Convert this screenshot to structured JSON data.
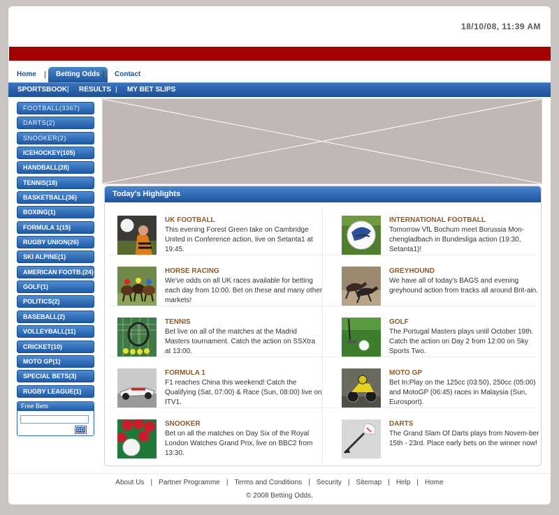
{
  "header": {
    "datetime": "18/10/08, 11:39 AM"
  },
  "top_nav": [
    {
      "label": "Home",
      "active": false
    },
    {
      "label": "Betting Odds",
      "active": true
    },
    {
      "label": "Contact",
      "active": false
    }
  ],
  "sub_nav": [
    "SPORTSBOOK",
    "RESULTS",
    "MY BET SLIPS"
  ],
  "sports": [
    "FOOTBALL(3367)",
    "DARTS(2)",
    "SNOOKER(2)",
    "ICEHOCKEY(105)",
    "HANDBALL(28)",
    "TENNIS(18)",
    "BASKETBALL(36)",
    "BOXING(1)",
    "FORMULA 1(15)",
    "RUGBY UNION(26)",
    "SKI ALPINE(1)",
    "AMERICAN FOOTB.(24)",
    "GOLF(1)",
    "POLITICS(2)",
    "BASEBALL(2)",
    "VOLLEYBALL(11)",
    "CRICKET(10)",
    "MOTO GP(1)",
    "SPECIAL BETS(3)",
    "RUGBY LEAGUE(1)"
  ],
  "free_bets": {
    "title": "Free Bets",
    "value": "",
    "go_label": "GO"
  },
  "highlights": {
    "title": "Today's Highlights",
    "items": [
      {
        "title": "UK FOOTBALL",
        "text": "This evening Forest Green take on Cambridge United in Conference action, live on Setanta1 at 19:45.",
        "icon": "football-player-icon"
      },
      {
        "title": "INTERNATIONAL FOOTBALL",
        "text": "Tomorrow VfL Bochum meet Borussia Mon-chengladbach in Bundesliga action (19:30, Setanta1)!",
        "icon": "soccer-ball-icon"
      },
      {
        "title": "HORSE RACING",
        "text": "We've odds on all UK races available for betting each day from 10:00. Bet on these and many other markets!",
        "icon": "horse-racing-icon"
      },
      {
        "title": "GREYHOUND",
        "text": "We have all of today's BAGS and evening greyhound action from tracks all around Brit-ain.",
        "icon": "greyhound-icon"
      },
      {
        "title": "TENNIS",
        "text": "Bet live on all of the matches at the Madrid Masters tournament. Catch the action on SSXtra at 13:00.",
        "icon": "tennis-racket-icon"
      },
      {
        "title": "GOLF",
        "text": "The Portugal Masters plays until October 19th. Catch the action on Day 2 from 12:00 on Sky Sports Two.",
        "icon": "golf-ball-icon"
      },
      {
        "title": "FORMULA 1",
        "text": "F1 reaches China this weekend! Catch the Qualifying (Sat, 07:00) & Race (Sun, 08:00) live on ITV1.",
        "icon": "race-car-icon"
      },
      {
        "title": "MOTO GP",
        "text": "Bet In:Play on the 125cc (03:50), 250cc (05:00) and MotoGP (06:45) races in Malaysia (Sun, Eurosport).",
        "icon": "motorbike-icon"
      },
      {
        "title": "SNOOKER",
        "text": "Bet on all the matches on Day Six of the Royal London Watches Grand Prix, live on BBC2 from 13:30.",
        "icon": "snooker-balls-icon"
      },
      {
        "title": "DARTS",
        "text": "The Grand Slam Of Darts plays from Novem-ber 15th - 23rd. Place early bets on the winner now!",
        "icon": "dart-icon"
      }
    ]
  },
  "footer": {
    "links": [
      "About Us",
      "Partner Programme",
      "Terms and Conditions",
      "Security",
      "Sitemap",
      "Help",
      "Home"
    ],
    "copyright": "© 2008 Betting Odds."
  }
}
